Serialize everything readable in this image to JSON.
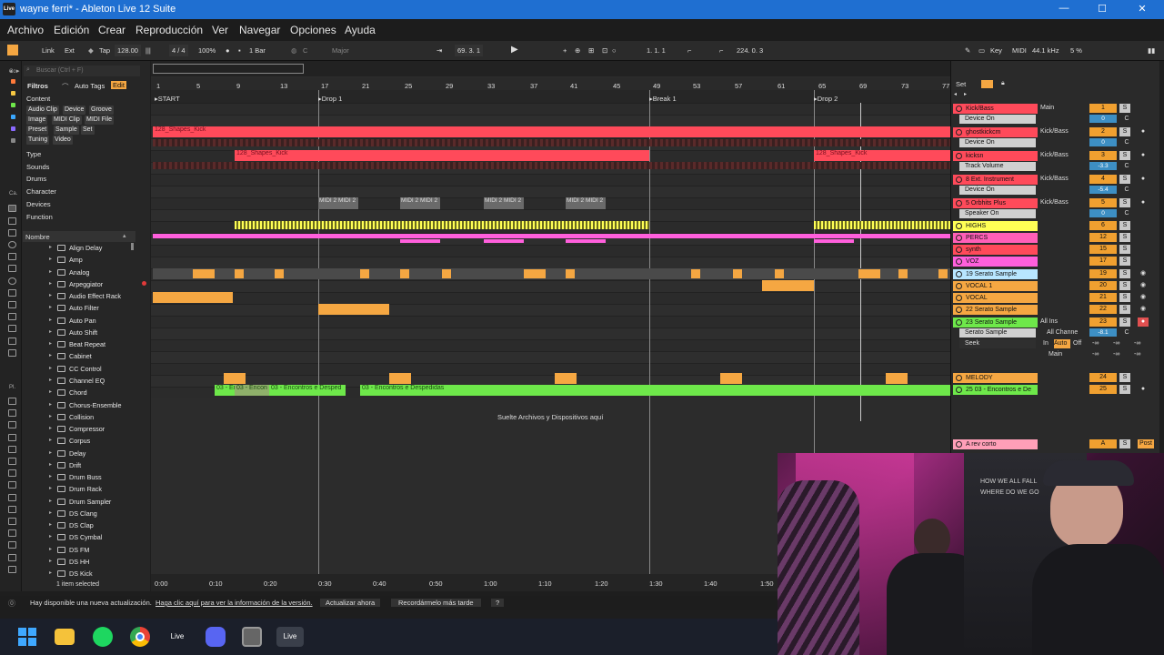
{
  "window": {
    "title": "wayne ferri* - Ableton Live 12 Suite",
    "app_icon": "Live",
    "minimize": "—",
    "maximize": "☐",
    "close": "✕"
  },
  "menu": [
    "Archivo",
    "Edición",
    "Crear",
    "Reproducción",
    "Ver",
    "Navegar",
    "Opciones",
    "Ayuda"
  ],
  "transport": {
    "link": "Link",
    "ext": "Ext",
    "tap": "Tap",
    "tempo": "128.00",
    "signature": "4 / 4",
    "zoom": "100%",
    "quantize": "1 Bar",
    "key": "C",
    "scale": "Major",
    "position": "69. 3. 1",
    "loop_start": "1. 1. 1",
    "loop_length": "224. 0. 3",
    "key_label": "Key",
    "midi_label": "MIDI",
    "sample_rate": "44.1 kHz",
    "cpu": "5 %"
  },
  "browser": {
    "search_placeholder": "Buscar (Ctrl + F)",
    "filters_label": "Filtros",
    "auto_tags": "Auto Tags",
    "edit": "Edit",
    "content_label": "Content",
    "chips_row1": [
      "Audio Clip",
      "Device",
      "Groove"
    ],
    "chips_row2": [
      "Image",
      "MIDI Clip",
      "MIDI File"
    ],
    "chips_row3": [
      "Preset",
      "Sample",
      "Set"
    ],
    "chips_row4": [
      "Tuning",
      "Video"
    ],
    "categories": [
      "Type",
      "Sounds",
      "Drums",
      "Character",
      "Devices",
      "Function"
    ],
    "name_header": "Nombre",
    "devices": [
      "Align Delay",
      "Amp",
      "Analog",
      "Arpeggiator",
      "Audio Effect Rack",
      "Auto Filter",
      "Auto Pan",
      "Auto Shift",
      "Beat Repeat",
      "Cabinet",
      "CC Control",
      "Channel EQ",
      "Chord",
      "Chorus-Ensemble",
      "Collision",
      "Compressor",
      "Corpus",
      "Delay",
      "Drift",
      "Drum Buss",
      "Drum Rack",
      "Drum Sampler",
      "DS Clang",
      "DS Clap",
      "DS Cymbal",
      "DS FM",
      "DS HH",
      "DS Kick"
    ],
    "selection": "1 item selected"
  },
  "arrangement": {
    "bars": [
      "1",
      "5",
      "9",
      "13",
      "17",
      "21",
      "25",
      "29",
      "33",
      "37",
      "41",
      "45",
      "49",
      "53",
      "57",
      "61",
      "65",
      "69",
      "73",
      "77"
    ],
    "locators": [
      "START",
      "Drop 1",
      "Break 1",
      "Drop 2"
    ],
    "clip_kick": "128_Shapes_Kick",
    "midi_clip": "MIDI 2 MIDI 2",
    "audio_clips": [
      "03 - En",
      "03 - Encon",
      "03 - Encontros e Desped",
      "03 - Encontros e Despedidas"
    ],
    "drop_hint": "Suelte Archivos y Dispositivos aquí",
    "time_ruler": [
      "0:00",
      "0:10",
      "0:20",
      "0:30",
      "0:40",
      "0:50",
      "1:00",
      "1:10",
      "1:20",
      "1:30",
      "1:40",
      "1:50"
    ]
  },
  "mixer": {
    "set_label": "Set",
    "tracks": [
      {
        "name": "Kick/Bass",
        "color": "#ff4a5a",
        "device": "Device On",
        "route": "Main",
        "num": "1",
        "vol": "0"
      },
      {
        "name": "ghostkickcm",
        "color": "#ff4a5a",
        "device": "Device On",
        "route": "Kick/Bass",
        "num": "2",
        "vol": "0"
      },
      {
        "name": "kicksn",
        "color": "#ff4a5a",
        "device": "Track Volume",
        "route": "Kick/Bass",
        "num": "3",
        "vol": "-3.3"
      },
      {
        "name": "8 Ext. Instrument",
        "color": "#ff4a5a",
        "device": "Device On",
        "route": "Kick/Bass",
        "num": "4",
        "vol": "-5.4"
      },
      {
        "name": "5 Orbhits Plus",
        "color": "#ff4a5a",
        "device": "Speaker On",
        "route": "Kick/Bass",
        "num": "5",
        "vol": "0"
      }
    ],
    "simple_tracks": [
      {
        "name": "HIGHS",
        "color": "#ffff55",
        "num": "6"
      },
      {
        "name": "PERCS",
        "color": "#ff5fb8",
        "num": "12"
      },
      {
        "name": "synth",
        "color": "#ff4a5a",
        "num": "15"
      },
      {
        "name": "VOZ",
        "color": "#ff5fdc",
        "num": "17"
      },
      {
        "name": "19 Serato Sample",
        "color": "#b8e6ff",
        "num": "19"
      },
      {
        "name": "VOCAL 1",
        "color": "#f5a742",
        "num": "20"
      },
      {
        "name": "VOCAL",
        "color": "#f5a742",
        "num": "21"
      },
      {
        "name": "22 Serato Sample",
        "color": "#f5a742",
        "num": "22"
      }
    ],
    "serato23": {
      "name": "23 Serato Sample",
      "device": "Serato Sample",
      "param": "Seek",
      "route_in": "All Ins",
      "route_ch": "All Channe",
      "num": "23",
      "vol": "-8.1",
      "in": "In",
      "auto": "Auto",
      "off": "Off",
      "out": "Main",
      "inf": "-∞"
    },
    "melody": {
      "name": "MELODY",
      "num": "24"
    },
    "encontros": {
      "name": "25 03 - Encontros e De",
      "num": "25"
    },
    "return_a": {
      "name": "A rev corto",
      "num": "A",
      "post": "Post"
    },
    "solo": "S",
    "cue": "C"
  },
  "status": {
    "message": "Hay disponible una nueva actualización.",
    "link": "Haga clic aquí para ver la información de la versión.",
    "update_now": "Actualizar ahora",
    "remind_later": "Recordármelo más tarde",
    "help": "?"
  },
  "taskbar": {
    "live1": "Live",
    "live2": "Live"
  },
  "webcam": {
    "shirt_text_1": "HOW WE ALL FALL",
    "shirt_text_2": "WHERE DO WE GO"
  },
  "colors": {
    "red": "#ff4a5a",
    "orange": "#f5a742",
    "green": "#6ee84a",
    "yellow": "#ffff55",
    "pink": "#ff5fb8",
    "accent": "#f5a742"
  }
}
